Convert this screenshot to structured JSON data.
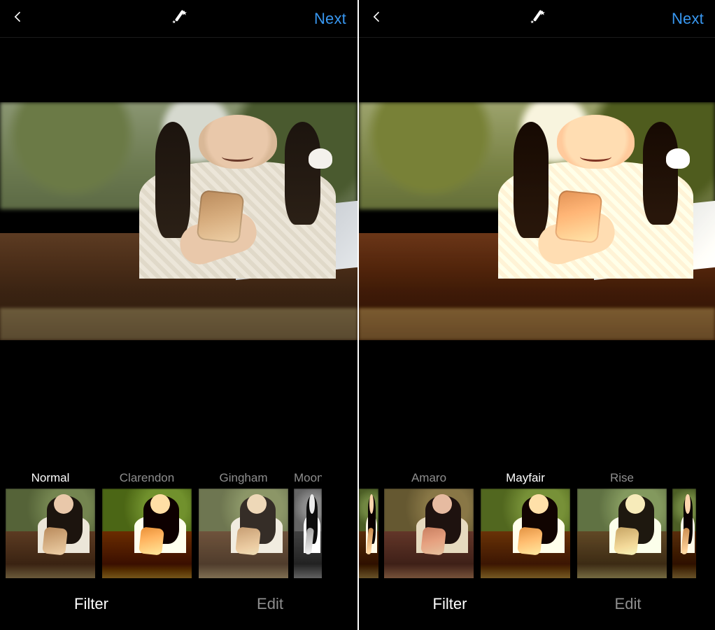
{
  "colors": {
    "accent": "#3897f0",
    "text_muted": "#8e8e8e",
    "text": "#ffffff",
    "bg": "#000000"
  },
  "left": {
    "header": {
      "next": "Next"
    },
    "filters": [
      {
        "name": "Normal",
        "selected": true
      },
      {
        "name": "Clarendon",
        "selected": false
      },
      {
        "name": "Gingham",
        "selected": false
      },
      {
        "name": "Moon",
        "selected": false,
        "partial": true
      }
    ],
    "tabs": {
      "filter": "Filter",
      "edit": "Edit",
      "active": "filter"
    }
  },
  "right": {
    "header": {
      "next": "Next"
    },
    "filters": [
      {
        "name": "",
        "selected": false,
        "partial_left": true
      },
      {
        "name": "Amaro",
        "selected": false
      },
      {
        "name": "Mayfair",
        "selected": true
      },
      {
        "name": "Rise",
        "selected": false
      },
      {
        "name": "",
        "selected": false,
        "partial": true
      }
    ],
    "tabs": {
      "filter": "Filter",
      "edit": "Edit",
      "active": "filter"
    }
  }
}
